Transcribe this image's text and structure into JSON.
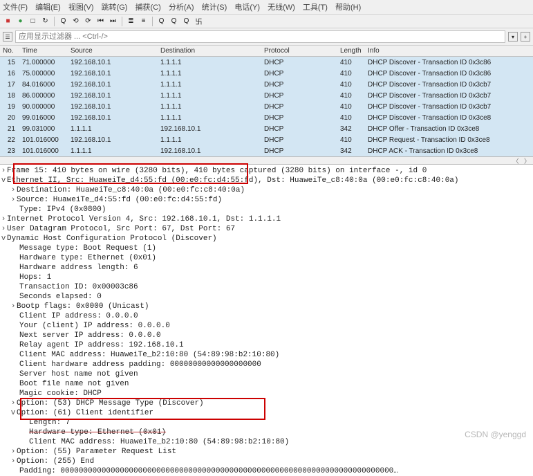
{
  "menu": {
    "items": [
      "文件(F)",
      "编辑(E)",
      "视图(V)",
      "跳转(G)",
      "捕获(C)",
      "分析(A)",
      "统计(S)",
      "电话(Y)",
      "无线(W)",
      "工具(T)",
      "帮助(H)"
    ]
  },
  "toolbar": {
    "icons": [
      "■",
      "●",
      "□",
      "↻",
      "Q",
      "⟲",
      "⟳",
      "⏮",
      "⏭",
      "≣",
      "≡",
      "⊞",
      "⊟",
      "Q",
      "Q",
      "Q",
      "卐"
    ]
  },
  "filter": {
    "placeholder": "应用显示过滤器 ... <Ctrl-/>"
  },
  "columns": {
    "no": "No.",
    "time": "Time",
    "source": "Source",
    "dest": "Destination",
    "proto": "Protocol",
    "len": "Length",
    "info": "Info"
  },
  "packets": [
    {
      "no": "15",
      "time": "71.000000",
      "src": "192.168.10.1",
      "dst": "1.1.1.1",
      "proto": "DHCP",
      "len": "410",
      "info": "DHCP Discover - Transaction ID 0x3c86"
    },
    {
      "no": "16",
      "time": "75.000000",
      "src": "192.168.10.1",
      "dst": "1.1.1.1",
      "proto": "DHCP",
      "len": "410",
      "info": "DHCP Discover - Transaction ID 0x3c86"
    },
    {
      "no": "17",
      "time": "84.016000",
      "src": "192.168.10.1",
      "dst": "1.1.1.1",
      "proto": "DHCP",
      "len": "410",
      "info": "DHCP Discover - Transaction ID 0x3cb7"
    },
    {
      "no": "18",
      "time": "86.000000",
      "src": "192.168.10.1",
      "dst": "1.1.1.1",
      "proto": "DHCP",
      "len": "410",
      "info": "DHCP Discover - Transaction ID 0x3cb7"
    },
    {
      "no": "19",
      "time": "90.000000",
      "src": "192.168.10.1",
      "dst": "1.1.1.1",
      "proto": "DHCP",
      "len": "410",
      "info": "DHCP Discover - Transaction ID 0x3cb7"
    },
    {
      "no": "20",
      "time": "99.016000",
      "src": "192.168.10.1",
      "dst": "1.1.1.1",
      "proto": "DHCP",
      "len": "410",
      "info": "DHCP Discover - Transaction ID 0x3ce8"
    },
    {
      "no": "21",
      "time": "99.031000",
      "src": "1.1.1.1",
      "dst": "192.168.10.1",
      "proto": "DHCP",
      "len": "342",
      "info": "DHCP Offer    - Transaction ID 0x3ce8"
    },
    {
      "no": "22",
      "time": "101.016000",
      "src": "192.168.10.1",
      "dst": "1.1.1.1",
      "proto": "DHCP",
      "len": "410",
      "info": "DHCP Request  - Transaction ID 0x3ce8"
    },
    {
      "no": "23",
      "time": "101.016000",
      "src": "1.1.1.1",
      "dst": "192.168.10.1",
      "proto": "DHCP",
      "len": "342",
      "info": "DHCP ACK      - Transaction ID 0x3ce8"
    }
  ],
  "details": {
    "frame": "Frame 15: 410 bytes on wire (3280 bits), 410 bytes captured (3280 bits) on interface -, id 0",
    "eth": "Ethernet II, Src: HuaweiTe_d4:55:fd (00:e0:fc:d4:55:fd), Dst: HuaweiTe_c8:40:0a (00:e0:fc:c8:40:0a)",
    "eth_dst": "Destination: HuaweiTe_c8:40:0a (00:e0:fc:c8:40:0a)",
    "eth_src": "Source: HuaweiTe_d4:55:fd (00:e0:fc:d4:55:fd)",
    "eth_type": "Type: IPv4 (0x0800)",
    "ip": "Internet Protocol Version 4, Src: 192.168.10.1, Dst: 1.1.1.1",
    "udp": "User Datagram Protocol, Src Port: 67, Dst Port: 67",
    "dhcp": "Dynamic Host Configuration Protocol (Discover)",
    "d_msgtype": "Message type: Boot Request (1)",
    "d_hwtype": "Hardware type: Ethernet (0x01)",
    "d_hlen": "Hardware address length: 6",
    "d_hops": "Hops: 1",
    "d_xid": "Transaction ID: 0x00003c86",
    "d_secs": "Seconds elapsed: 0",
    "d_flags": "Bootp flags: 0x0000 (Unicast)",
    "d_ciaddr": "Client IP address: 0.0.0.0",
    "d_yiaddr": "Your (client) IP address: 0.0.0.0",
    "d_siaddr": "Next server IP address: 0.0.0.0",
    "d_giaddr": "Relay agent IP address: 192.168.10.1",
    "d_chaddr": "Client MAC address: HuaweiTe_b2:10:80 (54:89:98:b2:10:80)",
    "d_chpad": "Client hardware address padding: 00000000000000000000",
    "d_sname": "Server host name not given",
    "d_file": "Boot file name not given",
    "d_cookie": "Magic cookie: DHCP",
    "d_opt53": "Option: (53) DHCP Message Type (Discover)",
    "d_opt61": "Option: (61) Client identifier",
    "d_opt61_len": "Length: 7",
    "d_opt61_hw": "Hardware type: Ethernet (0x01)",
    "d_opt61_mac": "Client MAC address: HuaweiTe_b2:10:80 (54:89:98:b2:10:80)",
    "d_opt55": "Option: (55) Parameter Request List",
    "d_opt255": "Option: (255) End",
    "d_pad": "Padding: 0000000000000000000000000000000000000000000000000000000000000000000000000…"
  },
  "watermark": "CSDN @yenggd"
}
